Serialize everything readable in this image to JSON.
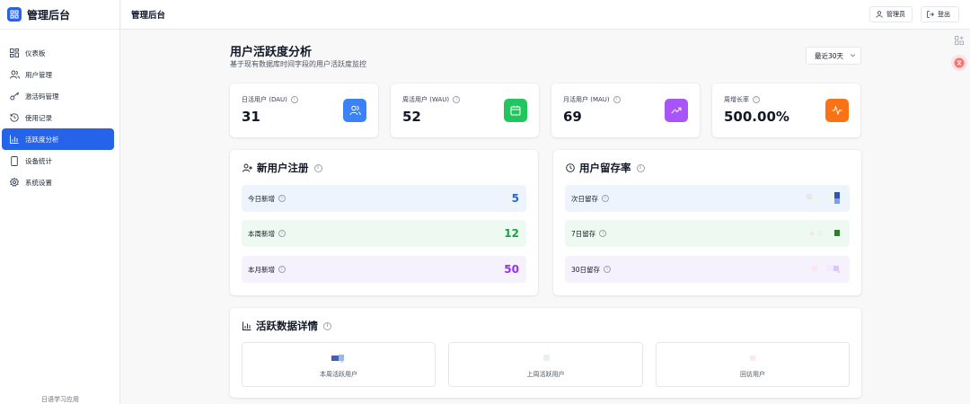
{
  "app": {
    "title": "管理后台",
    "footer": "日语学习应用"
  },
  "sidebar": {
    "items": [
      {
        "label": "仪表板",
        "icon": "dashboard-icon",
        "active": false
      },
      {
        "label": "用户管理",
        "icon": "users-icon",
        "active": false
      },
      {
        "label": "激活码管理",
        "icon": "key-icon",
        "active": false
      },
      {
        "label": "使用记录",
        "icon": "history-icon",
        "active": false
      },
      {
        "label": "活跃度分析",
        "icon": "bar-chart-icon",
        "active": true
      },
      {
        "label": "设备统计",
        "icon": "device-icon",
        "active": false
      },
      {
        "label": "系统设置",
        "icon": "gear-icon",
        "active": false
      }
    ]
  },
  "header": {
    "title": "管理后台",
    "user_label": "管理员",
    "logout_label": "登出"
  },
  "page": {
    "title": "用户活跃度分析",
    "subtitle": "基于现有数据库时间字段的用户活跃度监控",
    "range": "最近30天"
  },
  "stats": [
    {
      "label": "日活用户 (DAU)",
      "value": "31",
      "color": "#3b82f6",
      "icon": "users-icon"
    },
    {
      "label": "周活用户 (WAU)",
      "value": "52",
      "color": "#22c55e",
      "icon": "calendar-icon"
    },
    {
      "label": "月活用户 (MAU)",
      "value": "69",
      "color": "#a855f7",
      "icon": "trending-up-icon"
    },
    {
      "label": "周增长率",
      "value": "500.00%",
      "color": "#f97316",
      "icon": "activity-icon"
    }
  ],
  "new_users": {
    "title": "新用户注册",
    "rows": [
      {
        "label": "今日新增",
        "value": "5",
        "bg": "#eef4fd",
        "color": "#2563eb"
      },
      {
        "label": "本周新增",
        "value": "12",
        "bg": "#eefaf1",
        "color": "#16a34a"
      },
      {
        "label": "本月新增",
        "value": "50",
        "bg": "#f5f1fd",
        "color": "#9333ea"
      }
    ]
  },
  "retention": {
    "title": "用户留存率",
    "rows": [
      {
        "label": "次日留存",
        "bg": "#eef4fd"
      },
      {
        "label": "7日留存",
        "bg": "#eefaf1"
      },
      {
        "label": "30日留存",
        "bg": "#f5f1fd"
      }
    ]
  },
  "activity": {
    "title": "活跃数据详情",
    "cards": [
      {
        "label": "本周活跃用户"
      },
      {
        "label": "上周活跃用户"
      },
      {
        "label": "回访用户"
      }
    ]
  }
}
